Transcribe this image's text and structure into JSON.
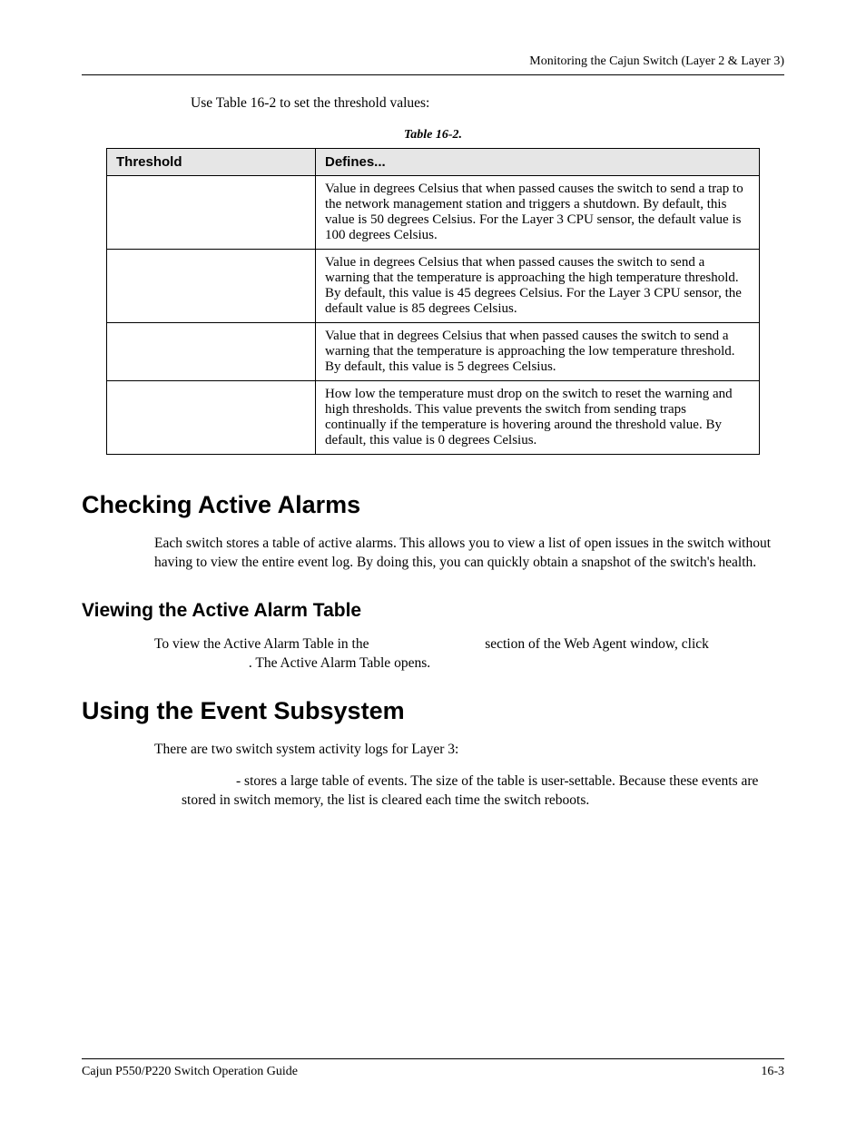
{
  "running_head": "Monitoring the Cajun Switch (Layer 2 & Layer 3)",
  "intro_line": "Use Table 16-2 to set the threshold values:",
  "table": {
    "caption": "Table 16-2.",
    "headers": [
      "Threshold",
      "Defines..."
    ],
    "rows": [
      {
        "threshold": "",
        "defines": "Value in degrees Celsius that when passed causes the switch to send a trap to the network management station and triggers a shutdown. By default, this value is 50 degrees Celsius. For the Layer 3 CPU sensor, the default value is 100 degrees Celsius."
      },
      {
        "threshold": "",
        "defines": "Value in degrees Celsius that when passed causes the switch to send a warning that the temperature is approaching the high temperature threshold. By default, this value is 45 degrees Celsius. For the Layer 3 CPU sensor, the default value is 85 degrees Celsius."
      },
      {
        "threshold": "",
        "defines": "Value that in degrees Celsius that when passed causes the switch to send a warning that the temperature is approaching the low temperature threshold. By default, this value is 5 degrees Celsius."
      },
      {
        "threshold": "",
        "defines": "How low the temperature must drop on the switch to reset the warning and high thresholds. This value prevents the switch from sending traps continually if the temperature is hovering around the threshold value. By default, this value is 0 degrees Celsius."
      }
    ]
  },
  "sections": {
    "checking_title": "Checking Active Alarms",
    "checking_body": "Each switch stores a table of active alarms. This allows you to view a list of open issues in the switch without having to view the entire event log. By doing this, you can quickly obtain a snapshot of the switch's health.",
    "viewing_title": "Viewing the Active Alarm Table",
    "viewing_body_1": "To view the Active Alarm Table in the",
    "viewing_body_2": "section of the Web Agent window, click",
    "viewing_body_3": ". The Active Alarm Table opens.",
    "using_title": "Using the Event Subsystem",
    "using_body": "There are two switch system activity logs for Layer 3:",
    "bullet_1a": "- stores a large table of events. The size of the table is user-settable. Because these events are stored in switch memory, the list is cleared each time the switch reboots."
  },
  "footer": {
    "left": "Cajun P550/P220 Switch Operation Guide",
    "right": "16-3"
  }
}
